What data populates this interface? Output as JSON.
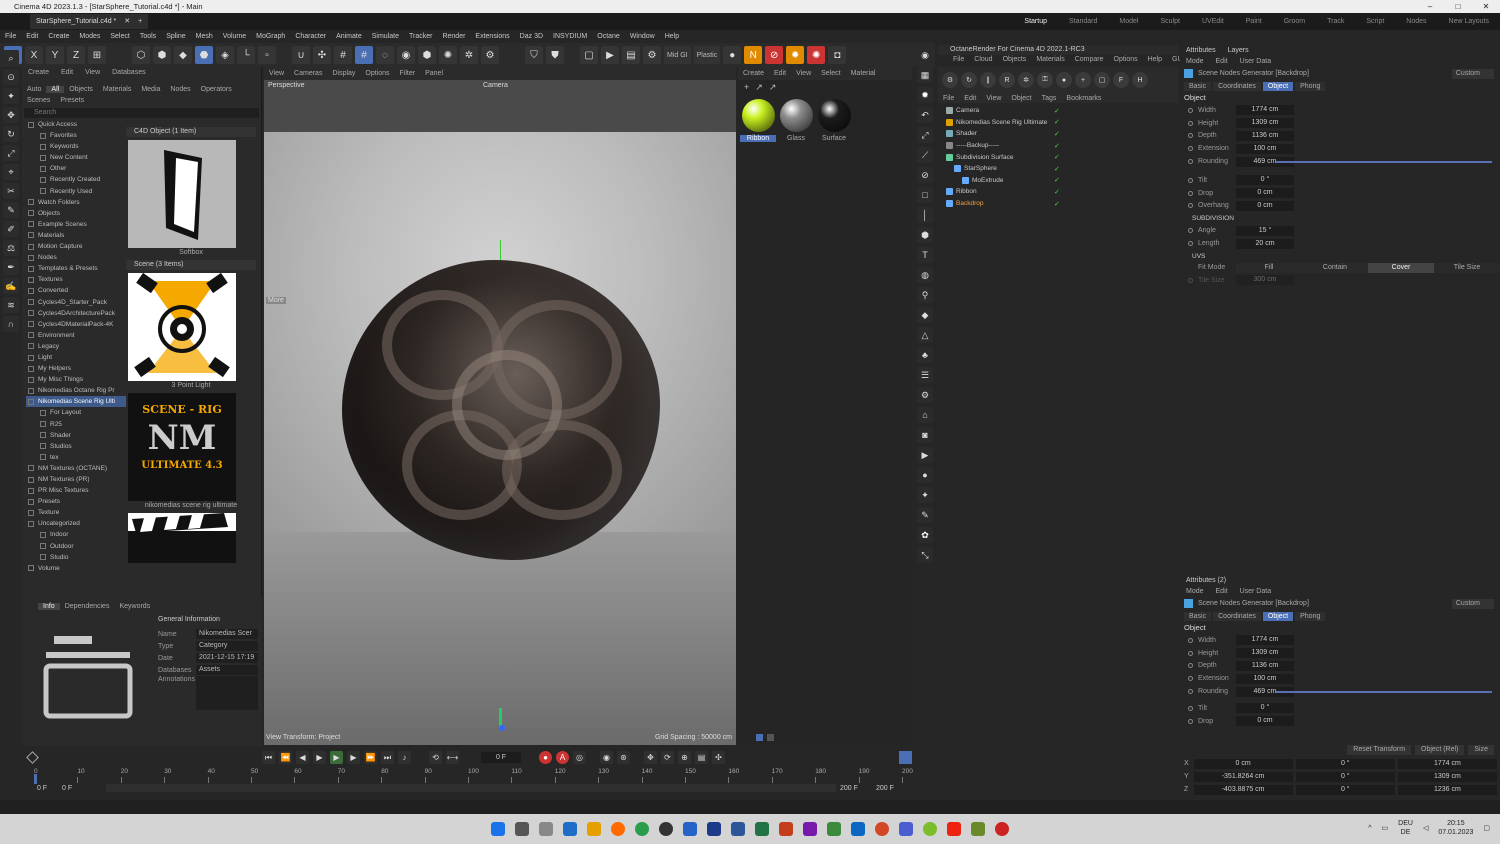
{
  "window": {
    "title": "Cinema 4D 2023.1.3 - [StarSphere_Tutorial.c4d *] - Main",
    "doc_tab": "StarSphere_Tutorial.c4d *"
  },
  "layouts": [
    "Startup",
    "Standard",
    "Model",
    "Sculpt",
    "UVEdit",
    "Paint",
    "Groom",
    "Track",
    "Script",
    "Nodes",
    "New Layouts"
  ],
  "menu": [
    "File",
    "Edit",
    "Create",
    "Modes",
    "Select",
    "Tools",
    "Spline",
    "Mesh",
    "Volume",
    "MoGraph",
    "Character",
    "Animate",
    "Simulate",
    "Tracker",
    "Render",
    "Extensions",
    "Daz 3D",
    "INSYDIUM",
    "Octane",
    "Window",
    "Help"
  ],
  "toolbar": {
    "axes": [
      "X",
      "Y",
      "Z"
    ],
    "mid_gi": "Mid GI",
    "plastic": "Plastic"
  },
  "asset_browser": {
    "menu": [
      "Create",
      "Edit",
      "View",
      "Databases"
    ],
    "tabs": [
      "Auto",
      "All",
      "Objects",
      "Materials",
      "Media",
      "Nodes",
      "Operators"
    ],
    "subtabs": [
      "Scenes",
      "Presets"
    ],
    "search_placeholder": "Search",
    "tree": [
      "Quick Access",
      "Favorites",
      "Keywords",
      "New Content",
      "Other",
      "Recently Created",
      "Recently Used",
      "Watch Folders",
      "Objects",
      "Example Scenes",
      "Materials",
      "Motion Capture",
      "Nodes",
      "Templates & Presets",
      "Textures",
      "Converted",
      "Cycles4D_Starter_Pack",
      "Cycles4DArchitecturePack",
      "Cycles4DMaterialPack-4K",
      "Environment",
      "Legacy",
      "Light",
      "My Helpers",
      "My Misc Things",
      "Nikomedias Octane Rig Pr",
      "Nikomedias Scene Rig Ulti",
      "For Layout",
      "R25",
      "Shader",
      "Studios",
      "tex",
      "NM Textures (OCTANE)",
      "NM Textures (PR)",
      "PR Misc Textures",
      "Presets",
      "Texture",
      "Uncategorized",
      "Indoor",
      "Outdoor",
      "Studio",
      "Volume"
    ],
    "section1": "C4D Object (1 Item)",
    "thumb1": "Softbox",
    "section2": "Scene (3 Items)",
    "thumb2": "3 Point Light",
    "thumb3": "nikomedias scene rig ultimate",
    "thumb3_art": {
      "line1": "SCENE - RIG",
      "logo": "NM",
      "line2": "ULTIMATE 4.3"
    }
  },
  "info_panel": {
    "tabs": [
      "Info",
      "Dependencies",
      "Keywords"
    ],
    "header": "General Information",
    "rows": [
      {
        "k": "Name",
        "v": "Nikomedias Scer"
      },
      {
        "k": "Type",
        "v": "Category"
      },
      {
        "k": "Date",
        "v": "2021-12-15 17:19"
      },
      {
        "k": "Databases",
        "v": "Assets"
      },
      {
        "k": "Annotations",
        "v": ""
      }
    ]
  },
  "viewport": {
    "menu": [
      "View",
      "Cameras",
      "Display",
      "Options",
      "Filter",
      "Panel"
    ],
    "name": "Perspective",
    "camera": "Camera",
    "note": "More",
    "bottom_left": "View Transform: Project",
    "bottom_right": "Grid Spacing : 50000 cm"
  },
  "material_manager": {
    "menu": [
      "Create",
      "Edit",
      "View",
      "Select",
      "Material"
    ],
    "materials": [
      {
        "name": "Ribbon",
        "color": "#c8f020"
      },
      {
        "name": "Glass",
        "color": "#8d8d8d"
      },
      {
        "name": "Surface",
        "color": "#1c1c1c"
      }
    ]
  },
  "object_manager": {
    "header": "OctaneRender For Cinema 4D 2022.1-RC3",
    "octane_menu": [
      "File",
      "Cloud",
      "Objects",
      "Materials",
      "Compare",
      "Options",
      "Help",
      "GUI"
    ],
    "menu": [
      "File",
      "Edit",
      "View",
      "Object",
      "Tags",
      "Bookmarks"
    ],
    "objects": [
      {
        "name": "Camera",
        "indent": 0,
        "color": "#9aa"
      },
      {
        "name": "Nikomedias Scene Rig Ultimate",
        "indent": 0,
        "color": "#e0a000"
      },
      {
        "name": "Shader",
        "indent": 0,
        "color": "#7ab"
      },
      {
        "name": "-----Backup-----",
        "indent": 0,
        "color": "#888"
      },
      {
        "name": "Subdivision Surface",
        "indent": 0,
        "color": "#6c9"
      },
      {
        "name": "StarSphere",
        "indent": 1,
        "color": "#6af"
      },
      {
        "name": "MoExtrude",
        "indent": 2,
        "color": "#6af"
      },
      {
        "name": "Ribbon",
        "indent": 0,
        "color": "#6af"
      },
      {
        "name": "Backdrop",
        "indent": 0,
        "color": "#6af",
        "selected": true
      }
    ]
  },
  "attributes": {
    "tabs": [
      "Attributes",
      "Layers"
    ],
    "mode": [
      "Mode",
      "Edit",
      "User Data"
    ],
    "object_name": "Scene Nodes Generator [Backdrop]",
    "preset": "Custom",
    "prop_tabs": [
      "Basic",
      "Coordinates",
      "Object",
      "Phong"
    ],
    "section": "Object",
    "fields": [
      {
        "k": "Width",
        "v": "1774 cm"
      },
      {
        "k": "Height",
        "v": "1309 cm"
      },
      {
        "k": "Depth",
        "v": "1136 cm"
      },
      {
        "k": "Extension",
        "v": "100 cm"
      },
      {
        "k": "Rounding",
        "v": "469 cm"
      }
    ],
    "fields2": [
      {
        "k": "Tilt",
        "v": "0 °"
      },
      {
        "k": "Drop",
        "v": "0 cm"
      },
      {
        "k": "Overhang",
        "v": "0 cm"
      }
    ],
    "subdivision": "SUBDIVISION",
    "sub_fields": [
      {
        "k": "Angle",
        "v": "15 °"
      },
      {
        "k": "Length",
        "v": "20 cm"
      }
    ],
    "uvs": "UVS",
    "fit_mode": {
      "k": "Fit Mode",
      "options": [
        "Fill",
        "Contain",
        "Cover",
        "Tile Size"
      ],
      "selected": "Cover"
    },
    "tile_size": {
      "k": "Tile Size",
      "v": "300 cm"
    }
  },
  "attributes2": {
    "title": "Attributes (2)",
    "fields2": [
      {
        "k": "Tilt",
        "v": "0 °"
      },
      {
        "k": "Drop",
        "v": "0 cm"
      }
    ]
  },
  "coordinates": {
    "buttons": [
      "Reset Transform",
      "Object (Rel)",
      "Size"
    ],
    "rows": [
      {
        "axis": "X",
        "pos": "0 cm",
        "rot": "0 °",
        "size": "1774 cm"
      },
      {
        "axis": "Y",
        "pos": "-351.8264 cm",
        "rot": "0 °",
        "size": "1309 cm"
      },
      {
        "axis": "Z",
        "pos": "-403.8875 cm",
        "rot": "0 °",
        "size": "1236 cm"
      }
    ]
  },
  "timeline": {
    "current_frame": "0 F",
    "ticks": [
      "0",
      "10",
      "20",
      "30",
      "40",
      "50",
      "60",
      "70",
      "80",
      "90",
      "100",
      "110",
      "120",
      "130",
      "140",
      "150",
      "160",
      "170",
      "180",
      "190",
      "200"
    ],
    "start": "0 F",
    "start2": "0 F",
    "end": "200 F",
    "end2": "200 F"
  },
  "tray": {
    "lang1": "DEU",
    "lang2": "DE",
    "time": "20:15",
    "date": "07.01.2023"
  }
}
